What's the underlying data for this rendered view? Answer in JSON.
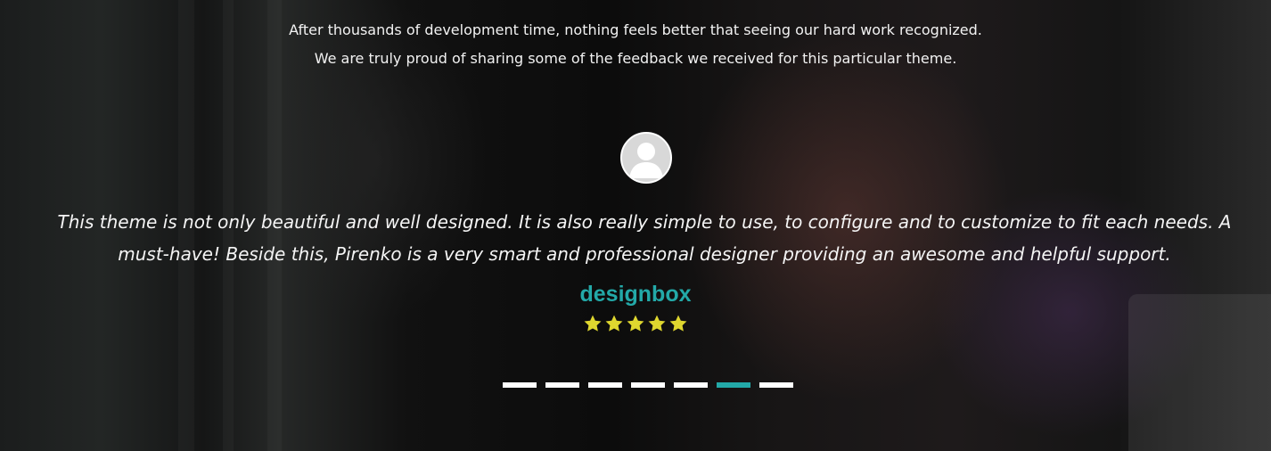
{
  "intro": {
    "line1": "After thousands of development time, nothing feels better that seeing our hard work recognized.",
    "line2": "We are truly proud of sharing some of the feedback we received for this particular theme."
  },
  "testimonial": {
    "quote": "This theme is not only beautiful and well designed. It is also really simple to use, to configure and to customize to fit each needs. A must-have! Beside this, Pirenko is a very smart and professional designer providing an awesome and helpful support.",
    "author": "designbox",
    "rating": 5,
    "rating_max": 5,
    "avatar_icon": "user-avatar-icon",
    "star_icon": "star-icon"
  },
  "carousel": {
    "slide_count": 7,
    "active_index": 5
  },
  "colors": {
    "accent": "#23a9a8",
    "star": "#dfd72f",
    "text": "#f2f2f2"
  }
}
